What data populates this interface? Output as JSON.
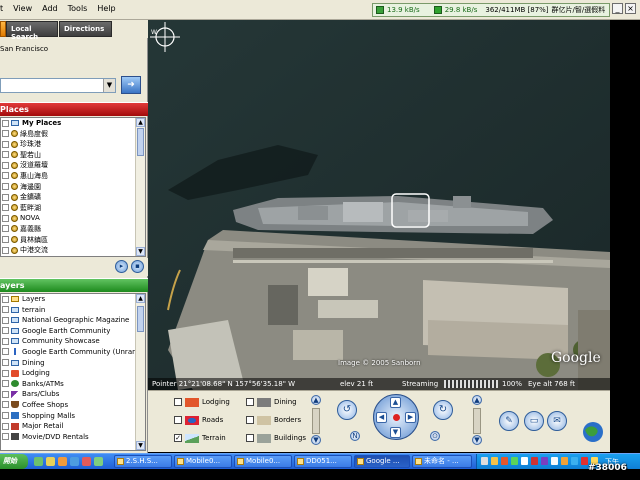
{
  "menubar": {
    "items": [
      "t",
      "View",
      "Add",
      "Tools",
      "Help"
    ],
    "status": {
      "download_rate": "13.9 kB/s",
      "upload_rate": "29.8 kB/s",
      "memory": "362/411MB [87%]",
      "ime_text": "群亿片/智/選假料"
    }
  },
  "left_panel": {
    "tabs": [
      "Local Search",
      "Directions"
    ],
    "search": {
      "label": "San Francisco",
      "value": "",
      "go_icon": "search-go-icon"
    },
    "places": {
      "title": "Places",
      "root": "My Places",
      "items": [
        "綠島度假",
        "珍珠港",
        "聖若山",
        "沒道羅壇",
        "惠山海島",
        "海邊園",
        "金鑛礦",
        "藍畔湖",
        "NOVA",
        "嘉義縣",
        "員林鎮區",
        "中港交流"
      ]
    },
    "layers": {
      "title": "ayers",
      "root": "Layers",
      "items": [
        "terrain",
        "National Geographic Magazine",
        "Google Earth Community",
        "Community Showcase",
        "Google Earth Community (Unranked)",
        "Dining",
        "Lodging",
        "Banks/ATMs",
        "Bars/Clubs",
        "Coffee Shops",
        "Shopping Malls",
        "Major Retail",
        "Movie/DVD Rentals"
      ]
    }
  },
  "map": {
    "credit": "Image © 2005 Sanborn",
    "logo": "Google",
    "status": {
      "pointer": "Pointer  21°21'08.68\" N  157°56'35.18\" W",
      "elev": "elev   21 ft",
      "streaming_label": "Streaming",
      "streaming_percent": "100%",
      "eye_alt": "Eye  alt     768 ft"
    }
  },
  "controls": {
    "layer_options": [
      {
        "label": "Lodging",
        "checked": false
      },
      {
        "label": "Dining",
        "checked": false
      },
      {
        "label": "Roads",
        "checked": false
      },
      {
        "label": "Borders",
        "checked": false
      },
      {
        "label": "Terrain",
        "checked": true
      },
      {
        "label": "Buildings",
        "checked": false
      }
    ]
  },
  "taskbar": {
    "start_label": "開始",
    "tasks": [
      "2.S.H.S...",
      "Mobile0...",
      "Mobile0...",
      "DD051...",
      "Google ...",
      "未命名 - ..."
    ],
    "clock": "下午 07:11"
  },
  "watermark": "#38006",
  "colors": {
    "places_header": "#c31414",
    "layers_header": "#2f9e2f",
    "taskbar": "#2f73e3",
    "water": "#1f2f30"
  }
}
